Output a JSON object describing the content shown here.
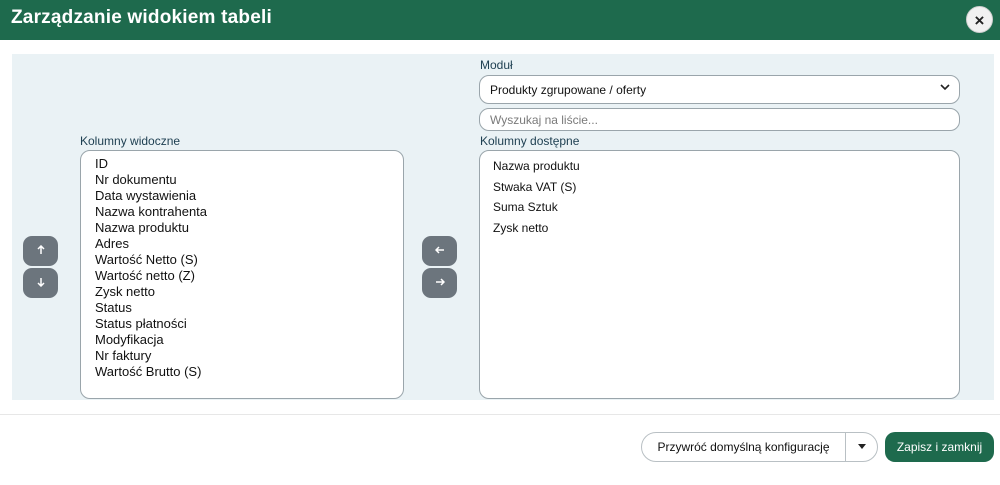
{
  "modal": {
    "title": "Zarządzanie widokiem tabeli",
    "close_symbol": "×"
  },
  "module": {
    "label": "Moduł",
    "selected": "Produkty zgrupowane / oferty"
  },
  "search": {
    "placeholder": "Wyszukaj na liście..."
  },
  "visible_columns": {
    "label": "Kolumny widoczne",
    "items": [
      "ID",
      "Nr dokumentu",
      "Data wystawienia",
      "Nazwa kontrahenta",
      "Nazwa produktu",
      "Adres",
      "Wartość Netto (S)",
      "Wartość netto (Z)",
      "Zysk netto",
      "Status",
      "Status płatności",
      "Modyfikacja",
      "Nr faktury",
      "Wartość Brutto (S)"
    ]
  },
  "available_columns": {
    "label": "Kolumny dostępne",
    "items": [
      "Nazwa produktu",
      "Stwaka VAT (S)",
      "Suma Sztuk",
      "Zysk netto"
    ]
  },
  "icons": {
    "up": "arrow-up-icon",
    "down": "arrow-down-icon",
    "left": "arrow-left-icon",
    "right": "arrow-right-icon",
    "caret": "caret-down-icon",
    "chevron": "chevron-down-icon"
  },
  "footer": {
    "restore_label": "Przywróć domyślną konfigurację",
    "save_label": "Zapisz i zamknij"
  },
  "colors": {
    "header": "#1e6a4d",
    "accent": "#1e6a4d",
    "button_gray": "#6c757d",
    "content_bg": "#eaf2f5"
  }
}
